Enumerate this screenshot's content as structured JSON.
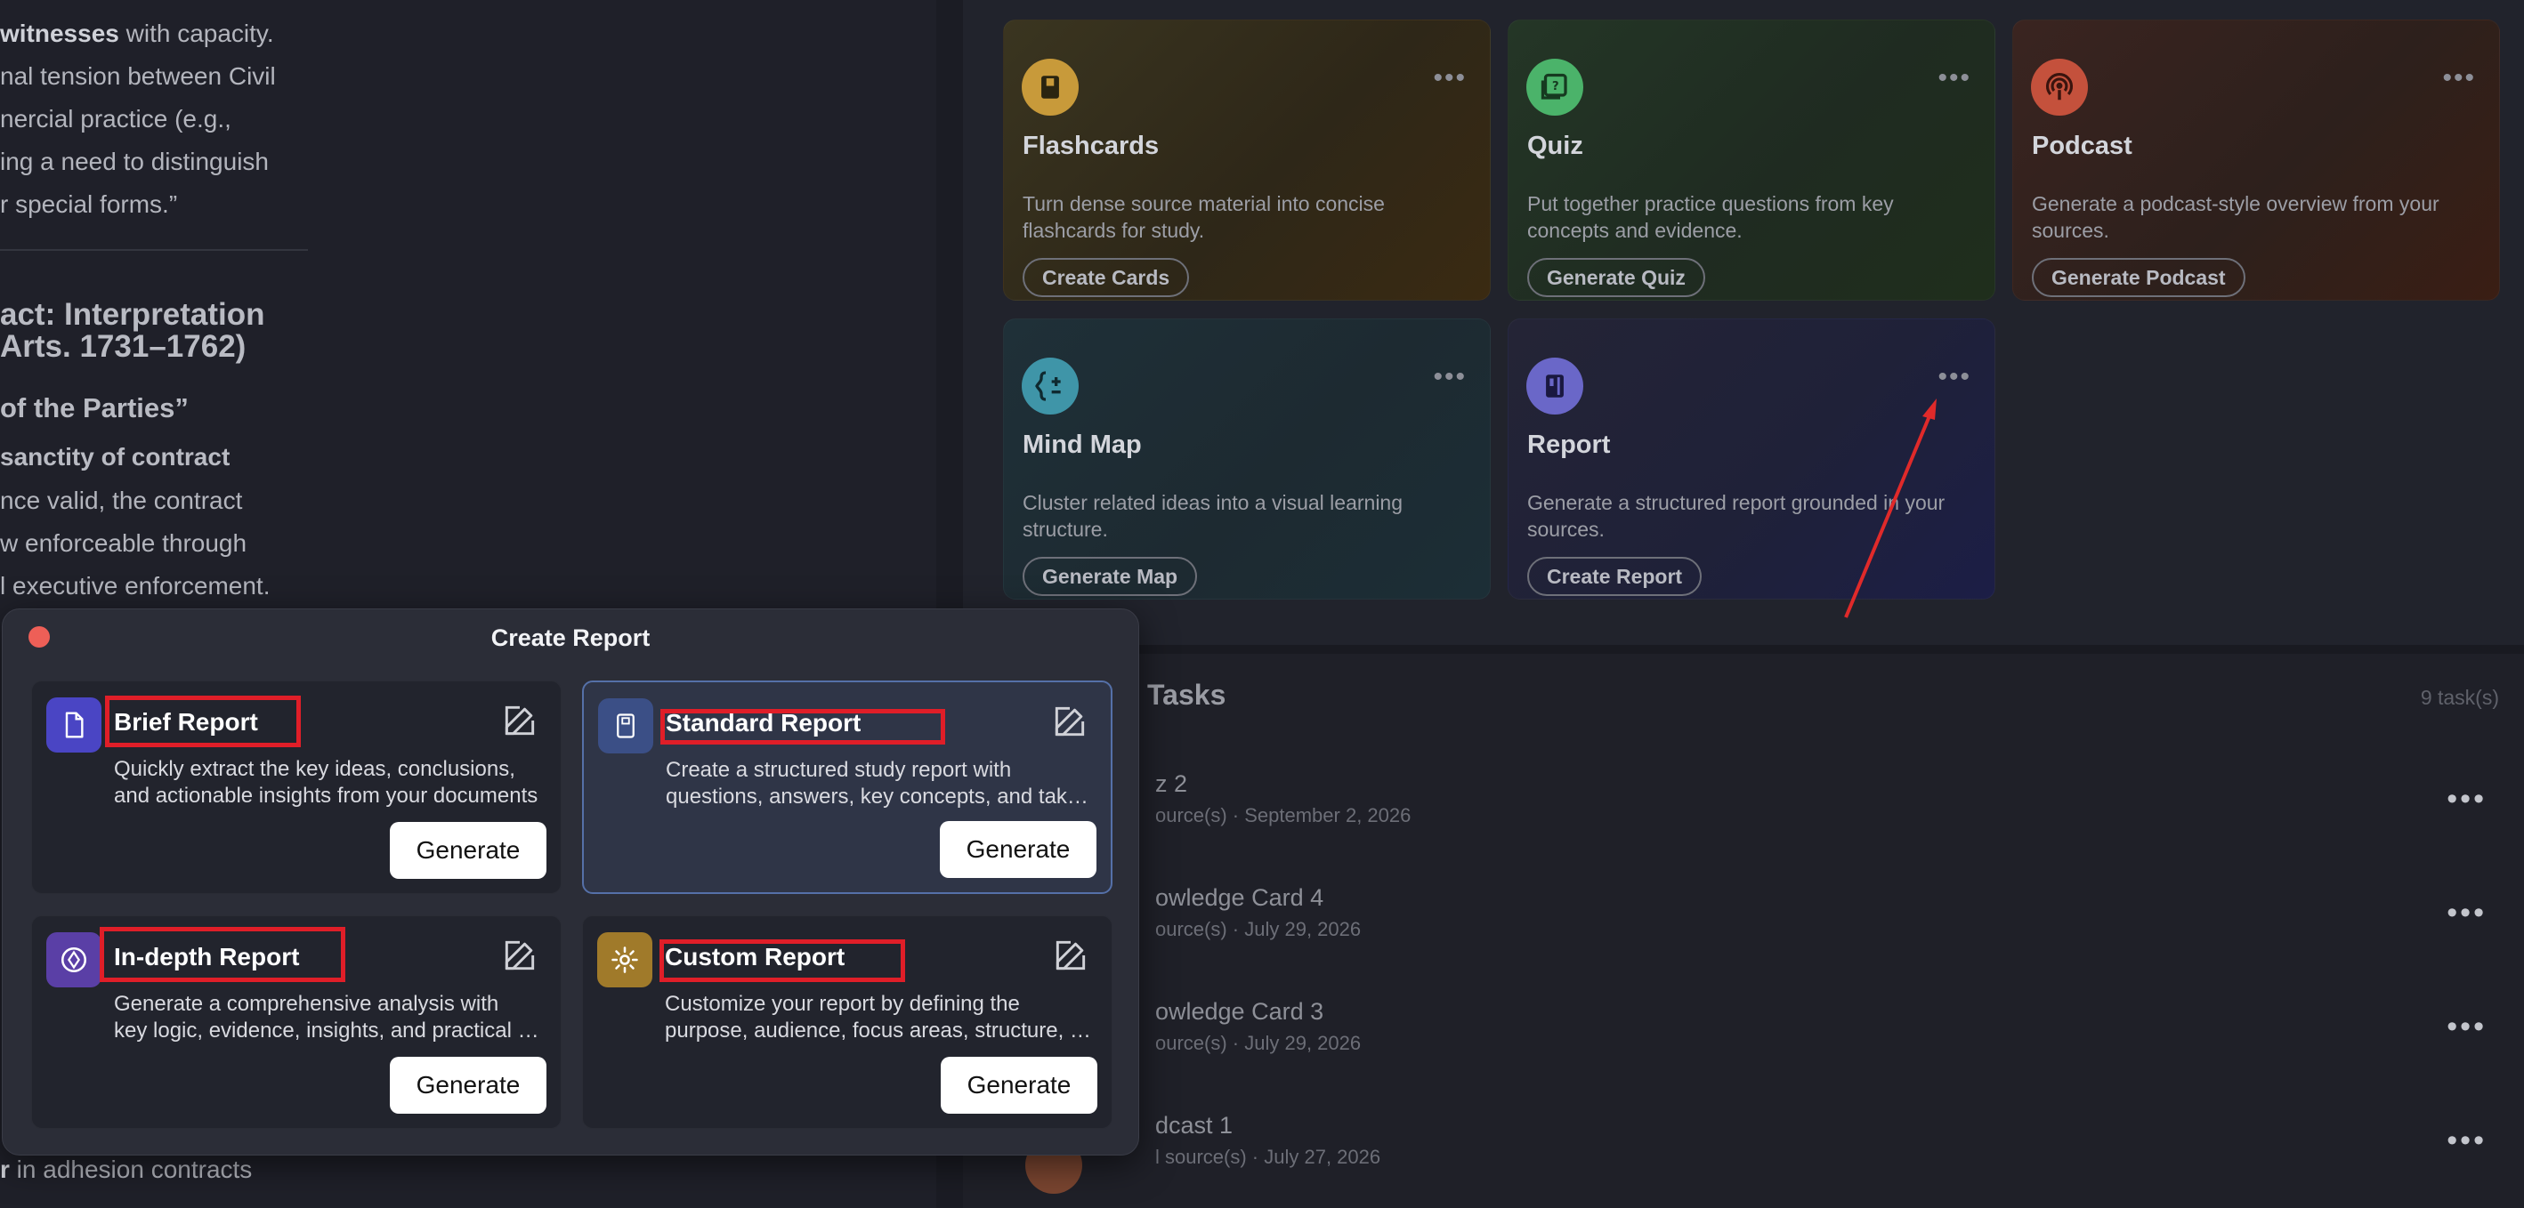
{
  "document": {
    "lines": [
      {
        "bold": "witnesses",
        "rest": " with capacity."
      },
      {
        "bold": "",
        "rest": "nal tension between Civil"
      },
      {
        "bold": "",
        "rest": "nercial practice (e.g.,"
      },
      {
        "bold": "",
        "rest": "ing a need to distinguish"
      },
      {
        "bold": "",
        "rest": "r special forms.”"
      }
    ],
    "heading_line1": "act: Interpretation",
    "heading_line2": "Arts. 1731–1762)",
    "subheading": "of the Parties”",
    "strong_line": "sanctity of contract",
    "body_lines": [
      "nce valid, the contract",
      "w enforceable through",
      "l executive enforcement."
    ],
    "bottom_bold": "r",
    "bottom_rest": " in adhesion contracts"
  },
  "studio": {
    "cards": [
      {
        "title": "Flashcards",
        "desc": "Turn dense source material into concise flashcards for study.",
        "button": "Create Cards",
        "icon": "book-icon",
        "color": "#c89a3a"
      },
      {
        "title": "Quiz",
        "desc": "Put together practice questions from key concepts and evidence.",
        "button": "Generate Quiz",
        "icon": "quiz-icon",
        "color": "#4bb36a"
      },
      {
        "title": "Podcast",
        "desc": "Generate a podcast-style overview from your sources.",
        "button": "Generate Podcast",
        "icon": "podcast-icon",
        "color": "#c4513c"
      },
      {
        "title": "Mind Map",
        "desc": "Cluster related ideas into a visual learning structure.",
        "button": "Generate Map",
        "icon": "mind-map-icon",
        "color": "#3f95a8"
      },
      {
        "title": "Report",
        "desc": "Generate a structured report grounded in your sources.",
        "button": "Create Report",
        "icon": "report-icon",
        "color": "#6a67c8"
      }
    ],
    "tasks_title": "Tasks",
    "tasks_count": "9 task(s)",
    "tasks": [
      {
        "title": "z 2",
        "meta": "ource(s) · September 2, 2026"
      },
      {
        "title": "owledge Card 4",
        "meta": "ource(s) · July 29, 2026"
      },
      {
        "title": "owledge Card 3",
        "meta": "ource(s) · July 29, 2026"
      },
      {
        "title": "dcast 1",
        "meta": "l source(s) · July 27, 2026"
      }
    ]
  },
  "modal": {
    "title": "Create Report",
    "generate_label": "Generate",
    "options": [
      {
        "title": "Brief Report",
        "desc1": "Quickly extract the key ideas, conclusions,",
        "desc2": "and actionable insights from your documents",
        "icon": "document-icon",
        "color": "#4a45c4"
      },
      {
        "title": "Standard Report",
        "desc1": "Create a structured study report with",
        "desc2": "questions, answers, key concepts, and takeaways",
        "icon": "notebook-icon",
        "color": "#3b4f86"
      },
      {
        "title": "In-depth Report",
        "desc1": "Generate a comprehensive analysis with",
        "desc2": "key logic, evidence, insights, and practical implications",
        "icon": "compass-icon",
        "color": "#5a3fa6"
      },
      {
        "title": "Custom Report",
        "desc1": "Customize your report by defining the",
        "desc2": "purpose, audience, focus areas, structure, and tone",
        "icon": "gear-icon",
        "color": "#a07a2a"
      }
    ]
  }
}
